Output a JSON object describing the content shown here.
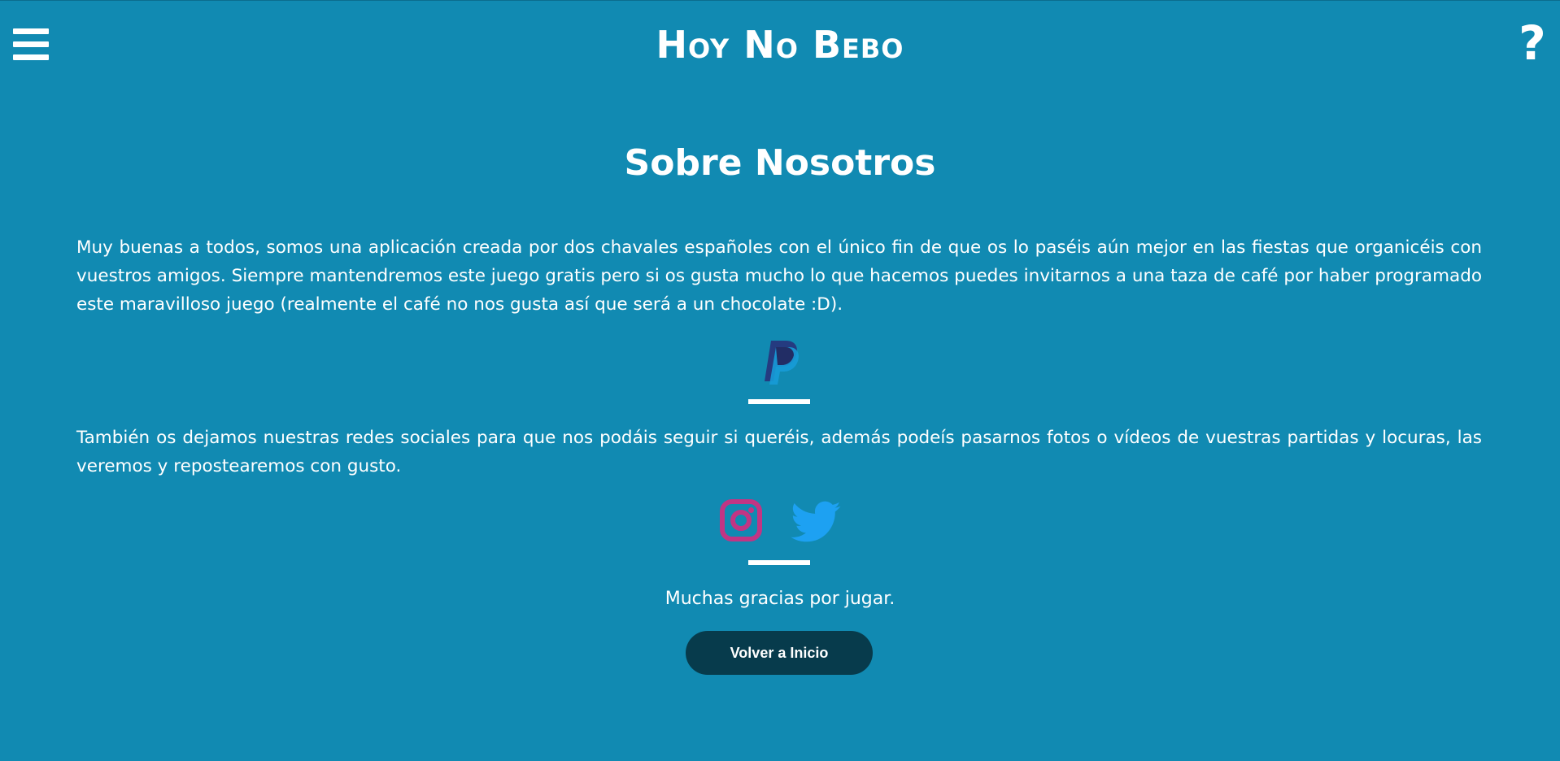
{
  "header": {
    "app_title": "Hoy No Bebo",
    "menu_icon": "hamburger-menu-icon",
    "help_label": "?"
  },
  "main": {
    "title": "Sobre Nosotros",
    "intro_paragraph": "Muy buenas a todos, somos una aplicación creada por dos chavales españoles con el único fin de que os lo paséis aún mejor en las fiestas que organicéis con vuestros amigos. Siempre mantendremos este juego gratis pero si os gusta mucho lo que hacemos puedes invitarnos a una taza de café por haber programado este maravilloso juego (realmente el café no nos gusta así que será a un chocolate :D).",
    "donate_icon": "paypal-icon",
    "social_paragraph": "También os dejamos nuestras redes sociales para que nos podáis seguir si queréis, además podeís pasarnos fotos o vídeos de vuestras partidas y locuras, las veremos y repostearemos con gusto.",
    "social_icons": [
      "instagram-icon",
      "twitter-icon"
    ],
    "thanks": "Muchas gracias por jugar.",
    "home_button_label": "Volver a Inicio"
  },
  "colors": {
    "background": "#118ab2",
    "button_bg": "#073b4c",
    "text": "#ffffff",
    "paypal_dark": "#253b80",
    "paypal_light": "#179bd7",
    "instagram": "#c13584",
    "twitter": "#1da1f2"
  }
}
